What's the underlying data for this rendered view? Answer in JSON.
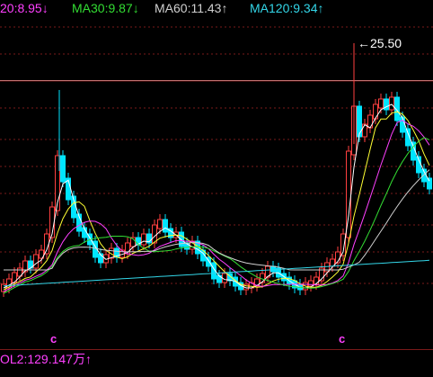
{
  "indicators": {
    "ma20": {
      "label": "20:8.95",
      "arrow": "↓",
      "color": "#ff40ff"
    },
    "ma30": {
      "label": "MA30:9.87",
      "arrow": "↓",
      "color": "#33dd33"
    },
    "ma60": {
      "label": "MA60:11.43",
      "arrow": "↑",
      "color": "#d0d0d0"
    },
    "ma120": {
      "label": "MA120:9.34",
      "arrow": "↑",
      "color": "#33d6e8"
    }
  },
  "peak": {
    "label": "25.50",
    "arrow": "←"
  },
  "volume": {
    "label": "OL2:129.147万",
    "arrow": "↑",
    "color": "#ff40ff"
  },
  "markers": [
    {
      "glyph": "c"
    },
    {
      "glyph": "c"
    }
  ],
  "colors": {
    "up": "#ff4040",
    "down": "#00e5ff",
    "grid": "#7a1a1a",
    "ma5": "#ffffff",
    "ma10": "#ffff33",
    "ma20": "#ff40ff",
    "ma30": "#33dd33",
    "ma60": "#d0d0d0",
    "ma120": "#33d6e8"
  }
}
